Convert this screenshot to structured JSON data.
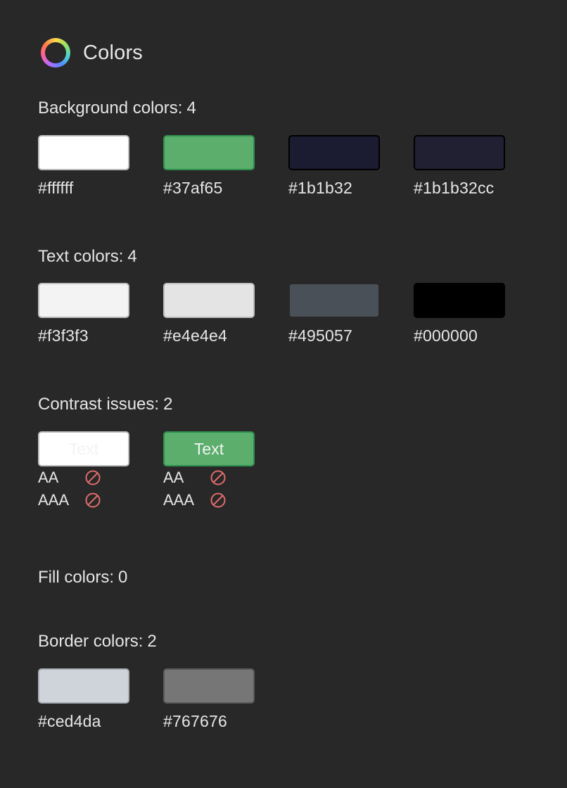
{
  "header": {
    "title": "Colors",
    "icon": "color-wheel-icon"
  },
  "sections": {
    "background": {
      "label": "Background colors:",
      "count": "4",
      "swatches": [
        {
          "color": "#ffffff",
          "label": "#ffffff"
        },
        {
          "color": "#37af65",
          "label": "#37af65"
        },
        {
          "color": "#1b1b32",
          "label": "#1b1b32"
        },
        {
          "color": "#1b1b32cc",
          "label": "#1b1b32cc"
        }
      ]
    },
    "text": {
      "label": "Text colors:",
      "count": "4",
      "swatches": [
        {
          "color": "#f3f3f3",
          "label": "#f3f3f3"
        },
        {
          "color": "#e4e4e4",
          "label": "#e4e4e4"
        },
        {
          "color": "#495057",
          "label": "#495057"
        },
        {
          "color": "#000000",
          "label": "#000000"
        }
      ]
    },
    "contrast": {
      "label": "Contrast issues:",
      "count": "2",
      "items": [
        {
          "sample_text": "Text",
          "background": "#ffffff",
          "foreground": "#f3f3f3",
          "ratings": [
            {
              "level": "AA",
              "status": "fail"
            },
            {
              "level": "AAA",
              "status": "fail"
            }
          ]
        },
        {
          "sample_text": "Text",
          "background": "#5bae6b",
          "foreground": "#f3f3f3",
          "ratings": [
            {
              "level": "AA",
              "status": "fail"
            },
            {
              "level": "AAA",
              "status": "fail"
            }
          ]
        }
      ]
    },
    "fill": {
      "label": "Fill colors:",
      "count": "0"
    },
    "border": {
      "label": "Border colors:",
      "count": "2",
      "swatches": [
        {
          "color": "#ced4da",
          "label": "#ced4da"
        },
        {
          "color": "#767676",
          "label": "#767676"
        }
      ]
    }
  },
  "colors": {
    "panel_background": "#282828",
    "fail_icon": "#e06c6c"
  }
}
